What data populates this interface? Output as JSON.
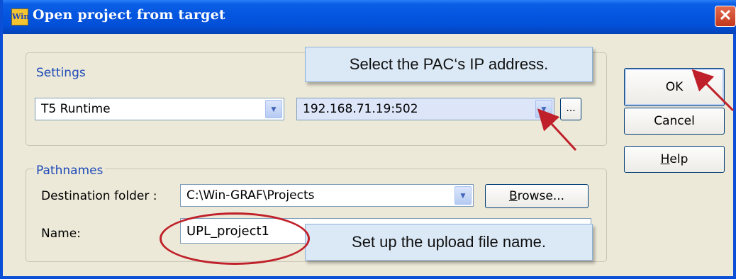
{
  "dialog": {
    "title": "Open project from target",
    "icon_text": "Win",
    "close_glyph": "✕"
  },
  "settings": {
    "group_label": "Settings",
    "runtime_combo": "T5 Runtime",
    "address_combo": "192.168.71.19:502",
    "dots_button": "..."
  },
  "pathnames": {
    "group_label": "Pathnames",
    "destination_label": "Destination folder :",
    "destination_value": "C:\\Win-GRAF\\Projects",
    "browse_button_prefix": "B",
    "browse_button_rest": "rowse...",
    "name_label": "Name:",
    "name_value": "UPL_project1"
  },
  "buttons": {
    "ok": "OK",
    "cancel": "Cancel",
    "help_prefix": "H",
    "help_rest": "elp"
  },
  "annotations": {
    "ip_callout": "Select the PAC‘s IP address.",
    "name_callout": "Set up the upload file name.",
    "highlight_color": "#c0202a"
  },
  "icons": {
    "combo_arrow": "▼"
  }
}
